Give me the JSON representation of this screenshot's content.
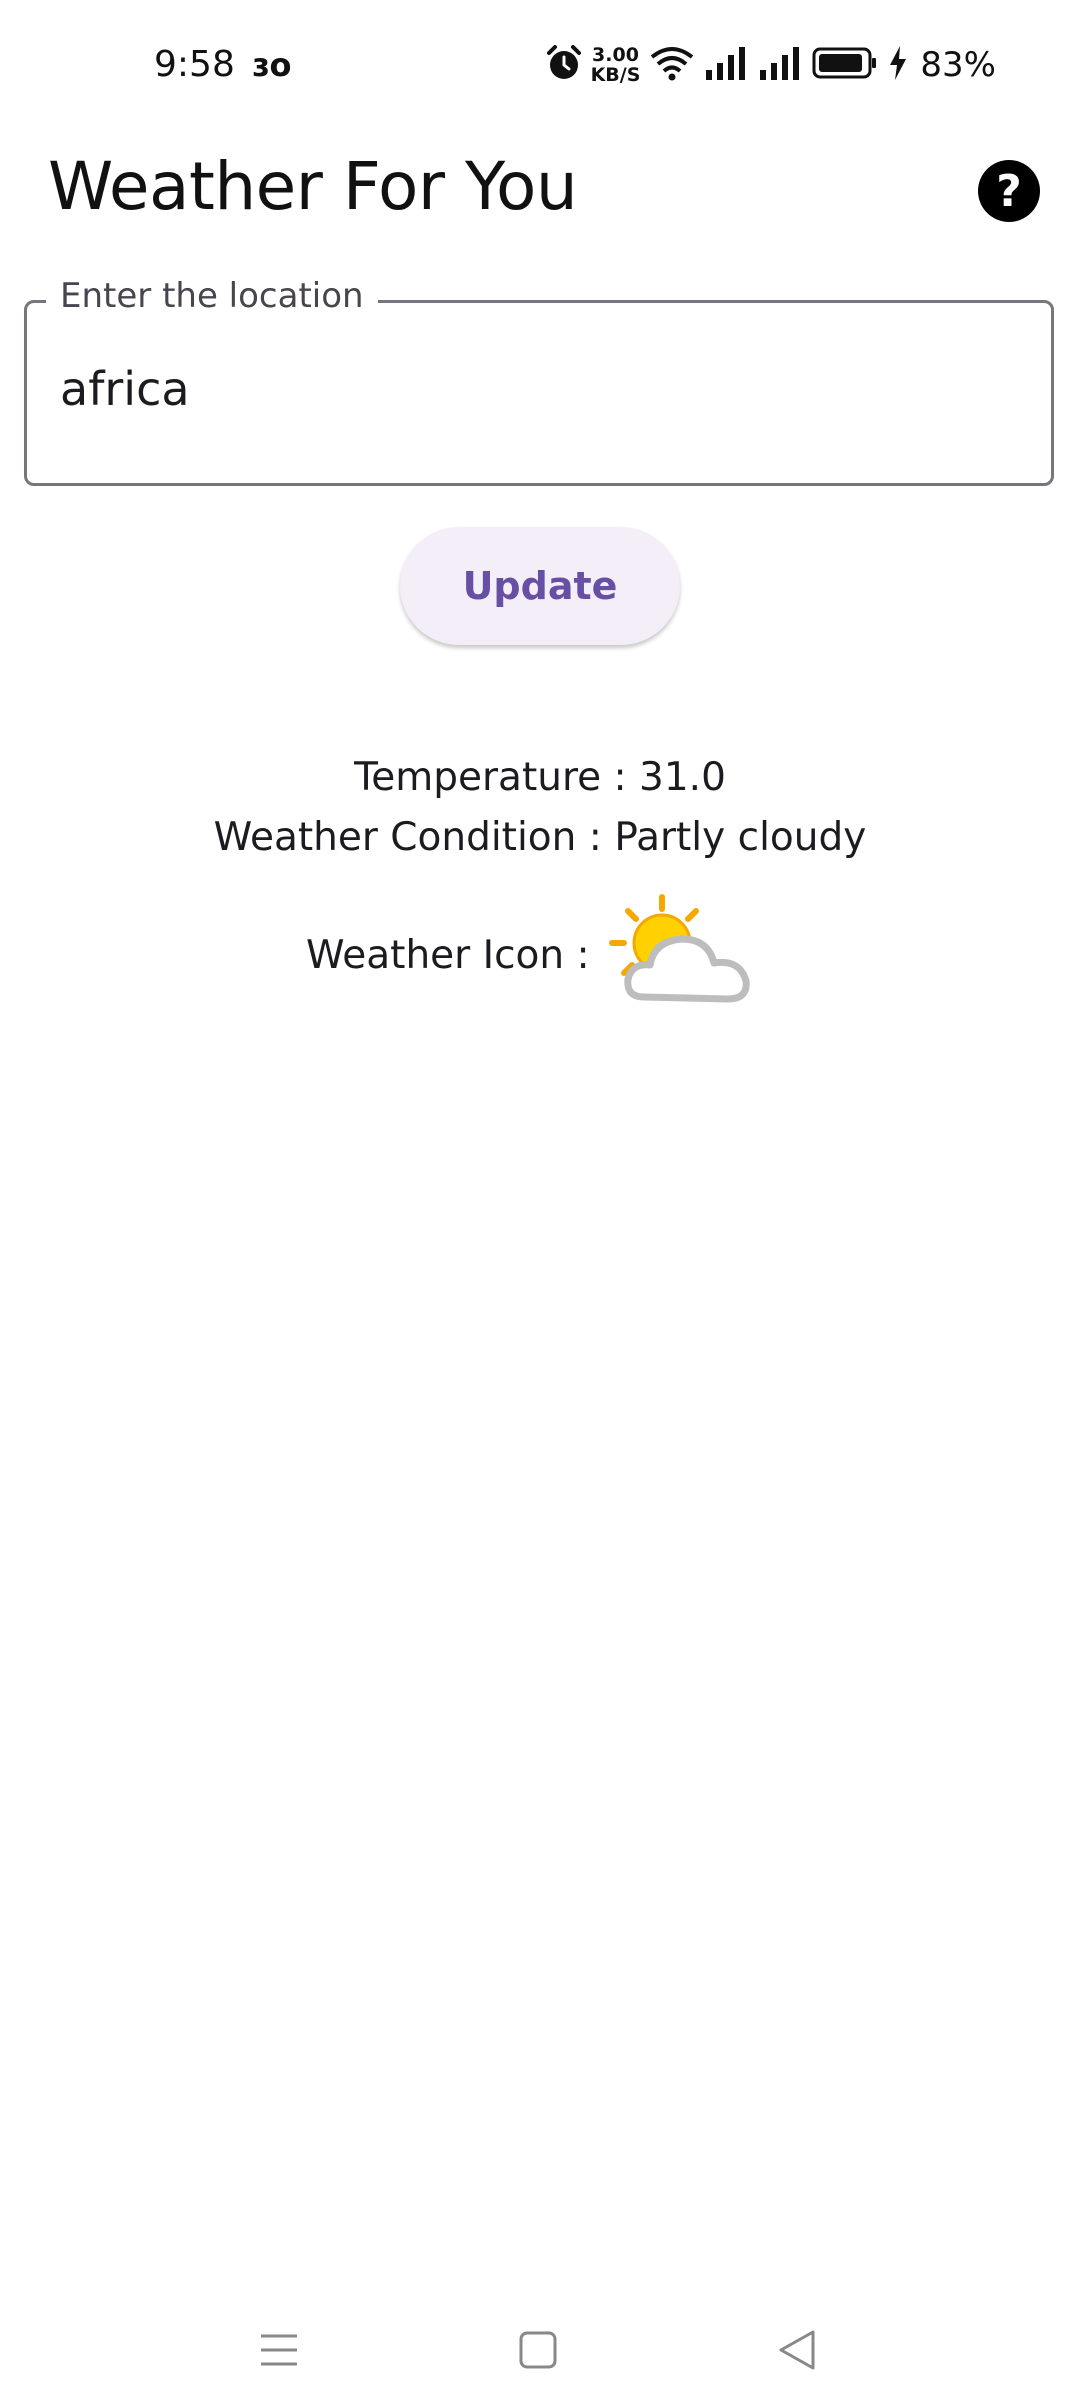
{
  "status_bar": {
    "time": "9:58",
    "notification": "ɜo",
    "network_speed_value": "3.00",
    "network_speed_unit": "KB/S",
    "battery_percent": "83%",
    "icons": [
      "alarm-icon",
      "wifi-icon",
      "signal-icon",
      "signal-icon",
      "battery-icon",
      "charging-icon"
    ]
  },
  "app_bar": {
    "title": "Weather For You",
    "help_icon": "help-icon"
  },
  "location_field": {
    "label": "Enter the location",
    "value": "africa"
  },
  "update_button": {
    "label": "Update"
  },
  "weather": {
    "temperature": "Temperature : 31.0",
    "condition": "Weather Condition : Partly cloudy",
    "icon_label": "Weather Icon :",
    "icon": "partly-cloudy-icon"
  },
  "nav_bar": {
    "icons": [
      "menu-icon",
      "home-square-icon",
      "back-triangle-icon"
    ]
  },
  "colors": {
    "accent": "#6750a4",
    "button_bg": "#f4eef9",
    "outline": "#79747e",
    "text": "#1c1b1f"
  }
}
